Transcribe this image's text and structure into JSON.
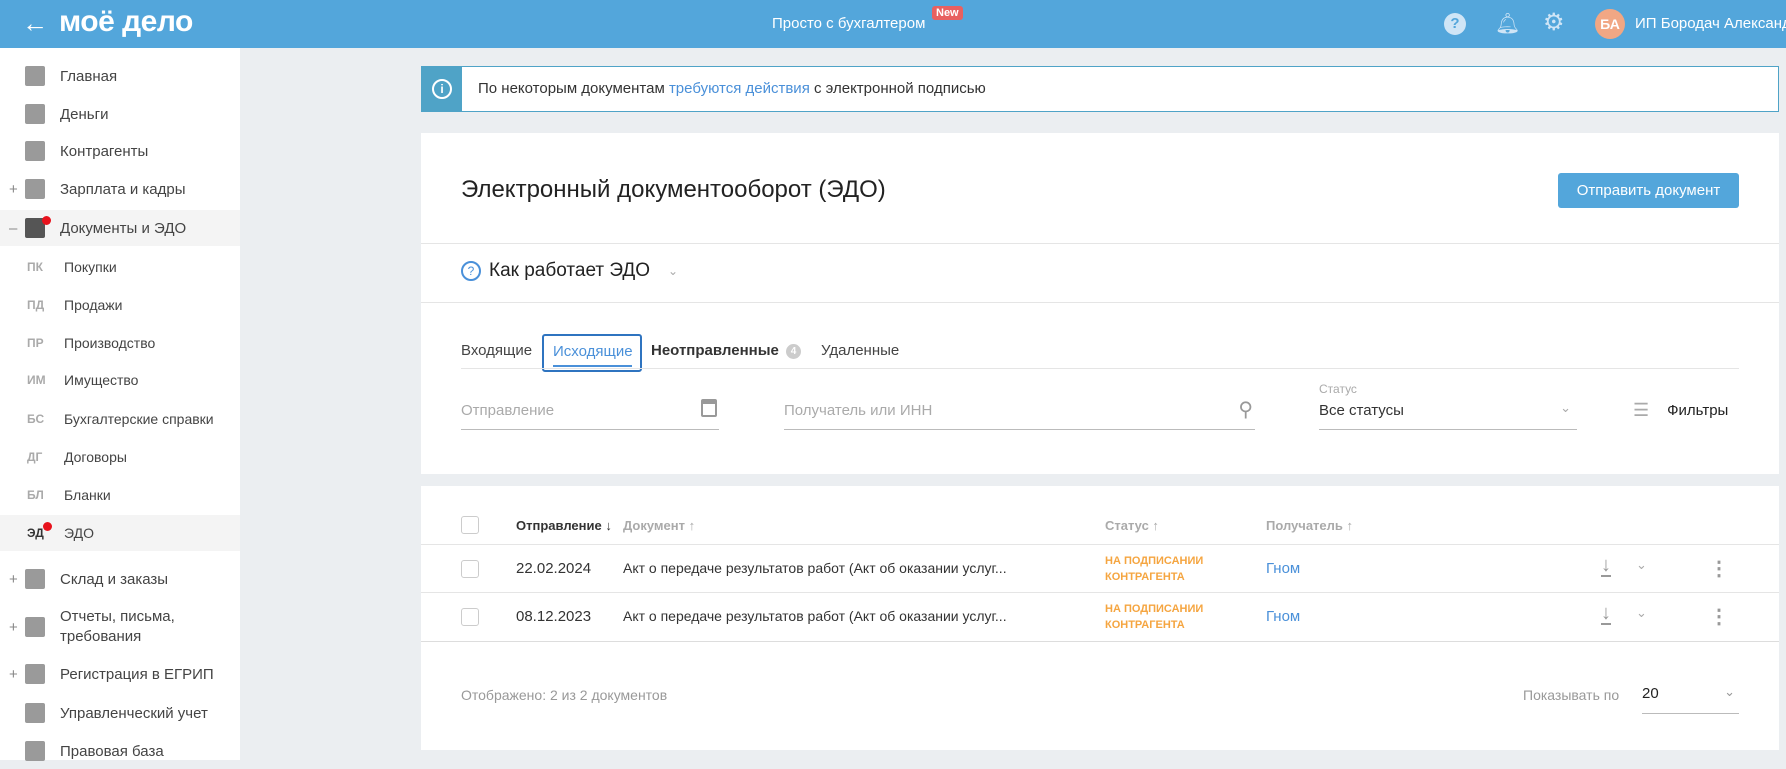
{
  "header": {
    "logo": "моё дело",
    "promo": "Просто с бухгалтером",
    "promo_badge": "New",
    "avatar_initials": "БА",
    "user_name": "ИП Бородач Александ"
  },
  "sidebar": {
    "items": [
      {
        "label": "Главная",
        "icon": "home-icon"
      },
      {
        "label": "Деньги",
        "icon": "money-icon"
      },
      {
        "label": "Контрагенты",
        "icon": "contractor-icon"
      },
      {
        "label": "Зарплата и кадры",
        "icon": "wallet-icon",
        "expand": "+"
      },
      {
        "label": "Документы и ЭДО",
        "icon": "folder-icon",
        "expand": "–"
      }
    ],
    "sub_items": [
      {
        "abbr": "ПК",
        "label": "Покупки"
      },
      {
        "abbr": "ПД",
        "label": "Продажи"
      },
      {
        "abbr": "ПР",
        "label": "Производство"
      },
      {
        "abbr": "ИМ",
        "label": "Имущество"
      },
      {
        "abbr": "БС",
        "label": "Бухгалтерские справки"
      },
      {
        "abbr": "ДГ",
        "label": "Договоры"
      },
      {
        "abbr": "БЛ",
        "label": "Бланки"
      },
      {
        "abbr": "ЭД",
        "label": "ЭДО"
      }
    ],
    "items2": [
      {
        "label": "Склад и заказы",
        "icon": "warehouse-icon",
        "expand": "+"
      },
      {
        "label": "Отчеты, письма, требования",
        "icon": "report-icon",
        "expand": "+"
      },
      {
        "label": "Регистрация в ЕГРИП",
        "icon": "registration-icon",
        "expand": "+"
      },
      {
        "label": "Управленческий учет",
        "icon": "ruble-icon"
      },
      {
        "label": "Правовая база",
        "icon": "briefcase-icon"
      }
    ]
  },
  "banner": {
    "text_before": "По некоторым документам ",
    "link": "требуются действия",
    "text_after": " с электронной подписью"
  },
  "page": {
    "title": "Электронный документооборот (ЭДО)",
    "send_button": "Отправить документ",
    "how_it_works": "Как работает ЭДО"
  },
  "tabs": [
    {
      "label": "Входящие"
    },
    {
      "label": "Исходящие",
      "active": true
    },
    {
      "label": "Неотправленные",
      "count": "4"
    },
    {
      "label": "Удаленные"
    }
  ],
  "filters": {
    "date_placeholder": "Отправление",
    "recipient_placeholder": "Получатель или ИНН",
    "status_label": "Статус",
    "status_value": "Все статусы",
    "filters_label": "Фильтры"
  },
  "table": {
    "columns": [
      "Отправление ↓",
      "Документ ↑",
      "Статус ↑",
      "Получатель ↑"
    ],
    "rows": [
      {
        "date": "22.02.2024",
        "document": "Акт о передаче результатов работ (Акт об оказании услуг...",
        "status_1": "НА ПОДПИСАНИИ",
        "status_2": "КОНТРАГЕНТА",
        "recipient": "Гном"
      },
      {
        "date": "08.12.2023",
        "document": "Акт о передаче результатов работ (Акт об оказании услуг...",
        "status_1": "НА ПОДПИСАНИИ",
        "status_2": "КОНТРАГЕНТА",
        "recipient": "Гном"
      }
    ]
  },
  "footer": {
    "shown": "Отображено: 2 из 2 документов",
    "per_page_label": "Показывать по",
    "per_page_value": "20"
  }
}
